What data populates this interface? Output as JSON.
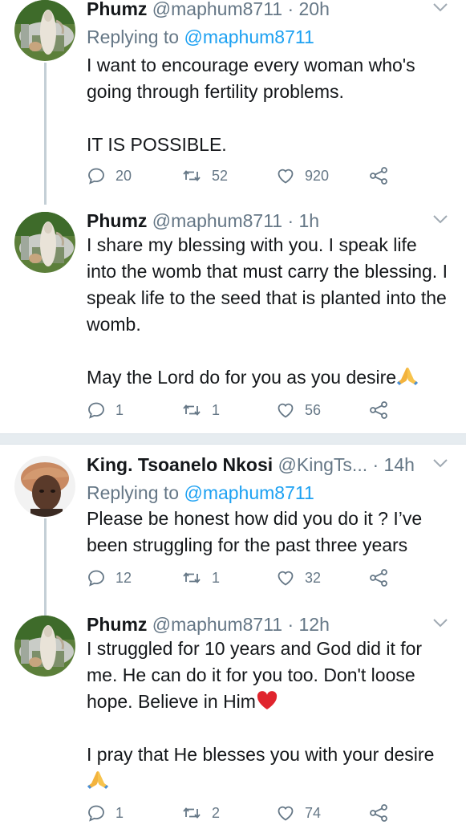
{
  "tweets": [
    {
      "name": "Phumz",
      "handle": "@maphum8711",
      "time": "· 20h",
      "replying_label": "Replying to ",
      "replying_to": "@maphum8711",
      "text": "I want to encourage every woman who's going through fertility problems.\n\nIT IS POSSIBLE.",
      "replies": "20",
      "retweets": "52",
      "likes": "920"
    },
    {
      "name": "Phumz",
      "handle": "@maphum8711",
      "time": "· 1h",
      "text": "I share my blessing with you. I speak life into the womb that must carry the blessing. I speak life to the seed that is planted into the womb.\n\nMay the Lord do for you as you desire",
      "replies": "1",
      "retweets": "1",
      "likes": "56"
    },
    {
      "name": "King. Tsoanelo Nkosi",
      "handle": "@KingTs...",
      "time": "· 14h",
      "replying_label": "Replying to ",
      "replying_to": "@maphum8711",
      "text": "Please be honest how did you do it ? I’ve been struggling for the past three years",
      "replies": "12",
      "retweets": "1",
      "likes": "32"
    },
    {
      "name": "Phumz",
      "handle": "@maphum8711",
      "time": "· 12h",
      "text1": "I struggled for 10 years and God did it for me. He can do it for you too. Don't loose hope. Believe in Him",
      "text2": "\n\nI pray that He blesses you with your desire",
      "replies": "1",
      "retweets": "2",
      "likes": "74"
    }
  ],
  "icons": {
    "reply": "reply-icon",
    "retweet": "retweet-icon",
    "like": "heart-icon",
    "share": "share-icon",
    "pray": "folded-hands-emoji",
    "heart_emoji": "red-heart-emoji"
  },
  "colors": {
    "text": "#14171a",
    "muted": "#657786",
    "link": "#1da1f2",
    "thread_line": "#c4cfd6",
    "separator": "#e6ecf0"
  }
}
